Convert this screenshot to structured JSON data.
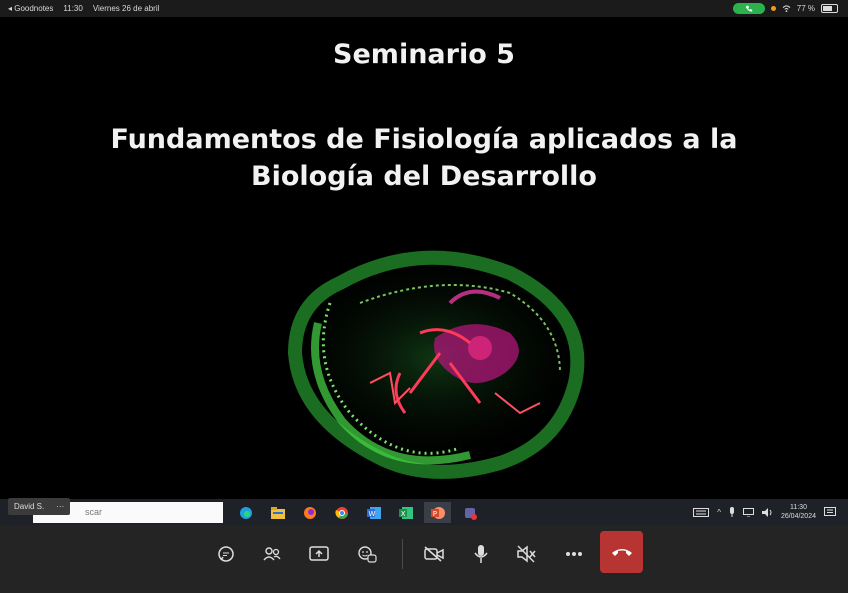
{
  "status_bar": {
    "back_app": "◂ Goodnotes",
    "time": "11:30",
    "date": "Viernes 26 de abril",
    "battery": "77 %",
    "battery_level": 0.77
  },
  "slide": {
    "title": "Seminario 5",
    "subtitle_line1": "Fundamentos de Fisiología aplicados a la",
    "subtitle_line2": "Biología del Desarrollo"
  },
  "participant": {
    "name": "David S.",
    "more": "···"
  },
  "taskbar": {
    "search_text": "scar",
    "apps": [
      {
        "icon": "edge-icon",
        "color": "#1fa0e0"
      },
      {
        "icon": "file-explorer-icon",
        "color": "#f0c040"
      },
      {
        "icon": "firefox-icon",
        "color": "#ff7a1a"
      },
      {
        "icon": "chrome-icon",
        "color": "#e94235"
      },
      {
        "icon": "word-icon",
        "color": "#2b6fd6"
      },
      {
        "icon": "excel-icon",
        "color": "#1f8f4d"
      },
      {
        "icon": "powerpoint-icon",
        "color": "#d64a2b"
      },
      {
        "icon": "teams-icon",
        "color": "#6264a7"
      }
    ],
    "clock_time": "11:30",
    "clock_date": "26/04/2024"
  },
  "call_controls": {
    "buttons": [
      "chat-icon",
      "people-icon",
      "share-screen-icon",
      "reactions-icon",
      "camera-off-icon",
      "microphone-icon",
      "speaker-off-icon",
      "more-icon",
      "hang-up-icon"
    ],
    "hangup_color": "#b63432"
  }
}
